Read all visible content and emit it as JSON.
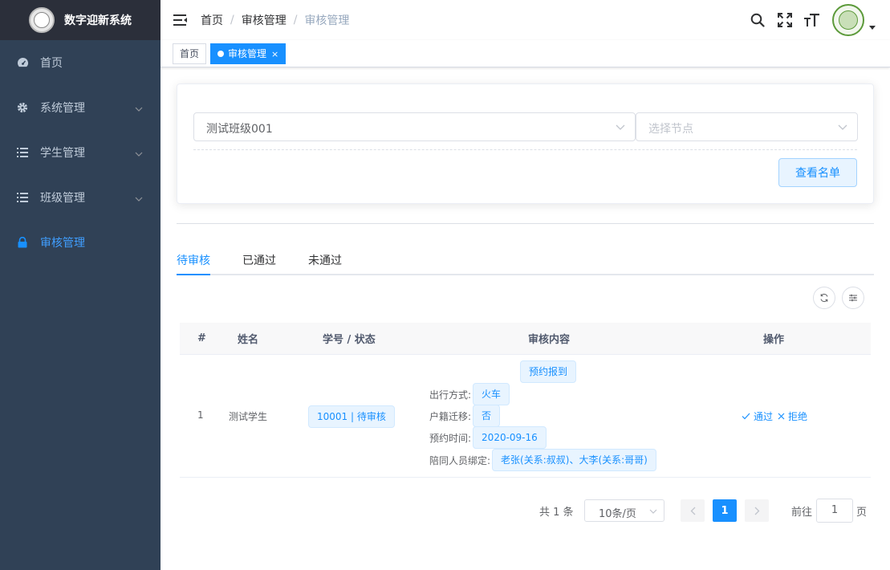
{
  "app": {
    "title": "数字迎新系统"
  },
  "sidebar": {
    "items": [
      {
        "label": "首页",
        "icon": "dashboard-icon",
        "has_children": false,
        "active": false
      },
      {
        "label": "系统管理",
        "icon": "gear-icon",
        "has_children": true,
        "active": false
      },
      {
        "label": "学生管理",
        "icon": "list-icon",
        "has_children": true,
        "active": false
      },
      {
        "label": "班级管理",
        "icon": "list-icon",
        "has_children": true,
        "active": false
      },
      {
        "label": "审核管理",
        "icon": "lock-icon",
        "has_children": false,
        "active": true
      }
    ]
  },
  "header": {
    "breadcrumb": [
      "首页",
      "审核管理",
      "审核管理"
    ],
    "icons": [
      "hamburger-icon",
      "search-icon",
      "fullscreen-icon",
      "font-size-icon",
      "avatar",
      "caret-down-icon"
    ]
  },
  "tags_view": {
    "tags": [
      {
        "label": "首页",
        "active": false
      },
      {
        "label": "审核管理",
        "active": true,
        "close": "×"
      }
    ]
  },
  "filter": {
    "class_value": "测试班级001",
    "node_placeholder": "选择节点",
    "view_list_button": "查看名单"
  },
  "tabs": [
    {
      "label": "待审核",
      "active": true
    },
    {
      "label": "已通过",
      "active": false
    },
    {
      "label": "未通过",
      "active": false
    }
  ],
  "table": {
    "columns": [
      "#",
      "姓名",
      "学号 / 状态",
      "审核内容",
      "操作"
    ],
    "rows": [
      {
        "index": "1",
        "name": "测试学生",
        "id_status": "10001 | 待审核",
        "content_title": "预约报到",
        "fields": [
          {
            "label": "出行方式:",
            "value": "火车"
          },
          {
            "label": "户籍迁移:",
            "value": "否"
          },
          {
            "label": "预约时间:",
            "value": "2020-09-16"
          },
          {
            "label": "陪同人员绑定:",
            "value": "老张(关系:叔叔)、大李(关系:哥哥)"
          }
        ],
        "actions": {
          "approve": "通过",
          "reject": "拒绝"
        }
      }
    ]
  },
  "pagination": {
    "total_text": "共 1 条",
    "page_size": "10条/页",
    "current_page": "1",
    "goto_label": "前往",
    "goto_value": "1",
    "page_suffix": "页"
  },
  "colors": {
    "sidebar_bg": "#304156",
    "logo_bg": "#2b2f3a",
    "primary": "#1890ff",
    "sidebar_text": "#bfcbd9"
  }
}
